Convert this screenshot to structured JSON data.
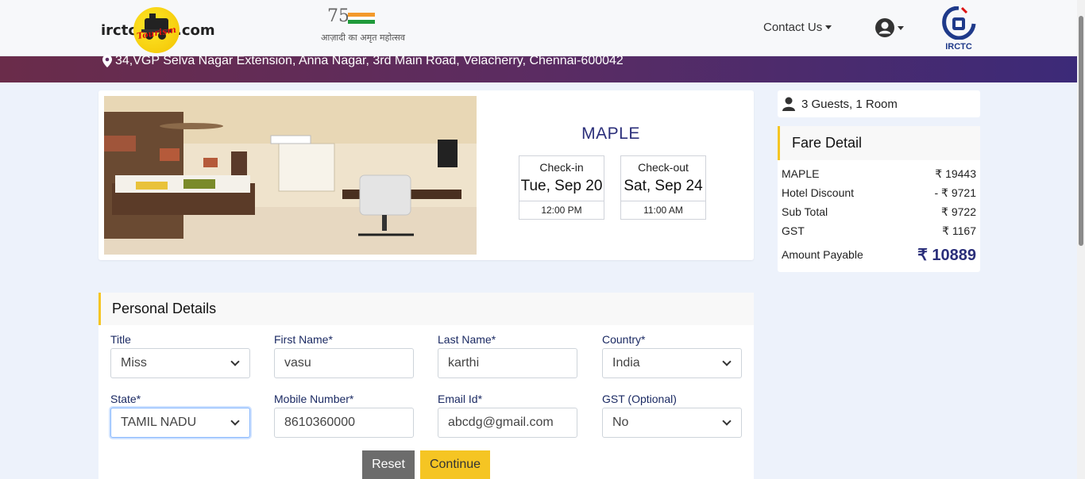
{
  "header": {
    "logo_left": "irctc",
    "logo_script": "Tourism",
    "logo_right": ".com",
    "azadi_num": "75",
    "azadi_text": "आज़ादी का अमृत महोत्सव",
    "contact_label": "Contact Us",
    "emblem_label": "IRCTC"
  },
  "band": {
    "address": "34,VGP Selva Nagar Extension, Anna Nagar, 3rd Main Road, Velacherry, Chennai-600042"
  },
  "hotel": {
    "name": "MAPLE",
    "checkin": {
      "label": "Check-in",
      "date": "Tue, Sep 20",
      "time": "12:00 PM"
    },
    "checkout": {
      "label": "Check-out",
      "date": "Sat, Sep 24",
      "time": "11:00 AM"
    }
  },
  "guests": {
    "text": "3 Guests, 1 Room"
  },
  "fare": {
    "title": "Fare Detail",
    "rows": [
      {
        "label": "MAPLE",
        "amount": "₹ 19443"
      },
      {
        "label": "Hotel Discount",
        "amount": "- ₹ 9721"
      },
      {
        "label": "Sub Total",
        "amount": "₹ 9722"
      },
      {
        "label": "GST",
        "amount": "₹ 1167"
      }
    ],
    "total": {
      "label": "Amount Payable",
      "amount": "₹ 10889"
    }
  },
  "personal": {
    "title": "Personal Details",
    "fields": {
      "title": {
        "label": "Title",
        "value": "Miss"
      },
      "first_name": {
        "label": "First Name*",
        "value": "vasu"
      },
      "last_name": {
        "label": "Last Name*",
        "value": "karthi"
      },
      "country": {
        "label": "Country*",
        "value": "India"
      },
      "state": {
        "label": "State*",
        "value": "TAMIL NADU"
      },
      "mobile": {
        "label": "Mobile Number*",
        "value": "8610360000"
      },
      "email": {
        "label": "Email Id*",
        "value": "abcdg@gmail.com"
      },
      "gst": {
        "label": "GST (Optional)",
        "value": "No"
      }
    },
    "reset_label": "Reset",
    "continue_label": "Continue"
  },
  "colors": {
    "accent_yellow": "#f5c523",
    "brand_navy": "#2b2f7a",
    "band_start": "#6a2c4a",
    "band_end": "#3c2a78"
  }
}
